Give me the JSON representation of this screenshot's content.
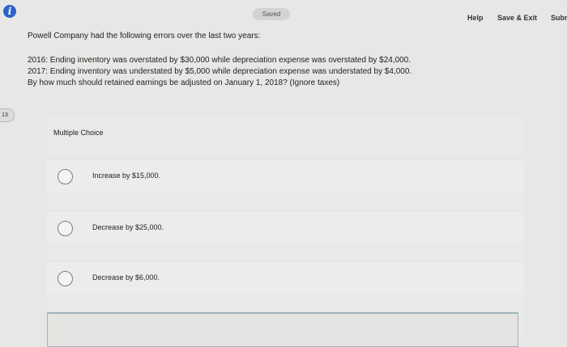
{
  "header": {
    "saved_status": "Saved",
    "help_label": "Help",
    "save_exit_label": "Save & Exit",
    "submit_label": "Subm"
  },
  "question": {
    "number_badge": "13",
    "intro": "Powell Company had the following errors over the last two years:",
    "lines": [
      "2016: Ending inventory was overstated by $30,000 while depreciation expense was overstated by $24,000.",
      "2017: Ending inventory was understated by $5,000 while depreciation expense was understated by $4,000.",
      "By how much should retained earnings be adjusted on January 1, 2018? (Ignore taxes)"
    ]
  },
  "multiple_choice": {
    "label": "Multiple Choice",
    "options": [
      {
        "text": "Increase by $15,000."
      },
      {
        "text": "Decrease by $25,000."
      },
      {
        "text": "Decrease by $6,000."
      }
    ]
  }
}
